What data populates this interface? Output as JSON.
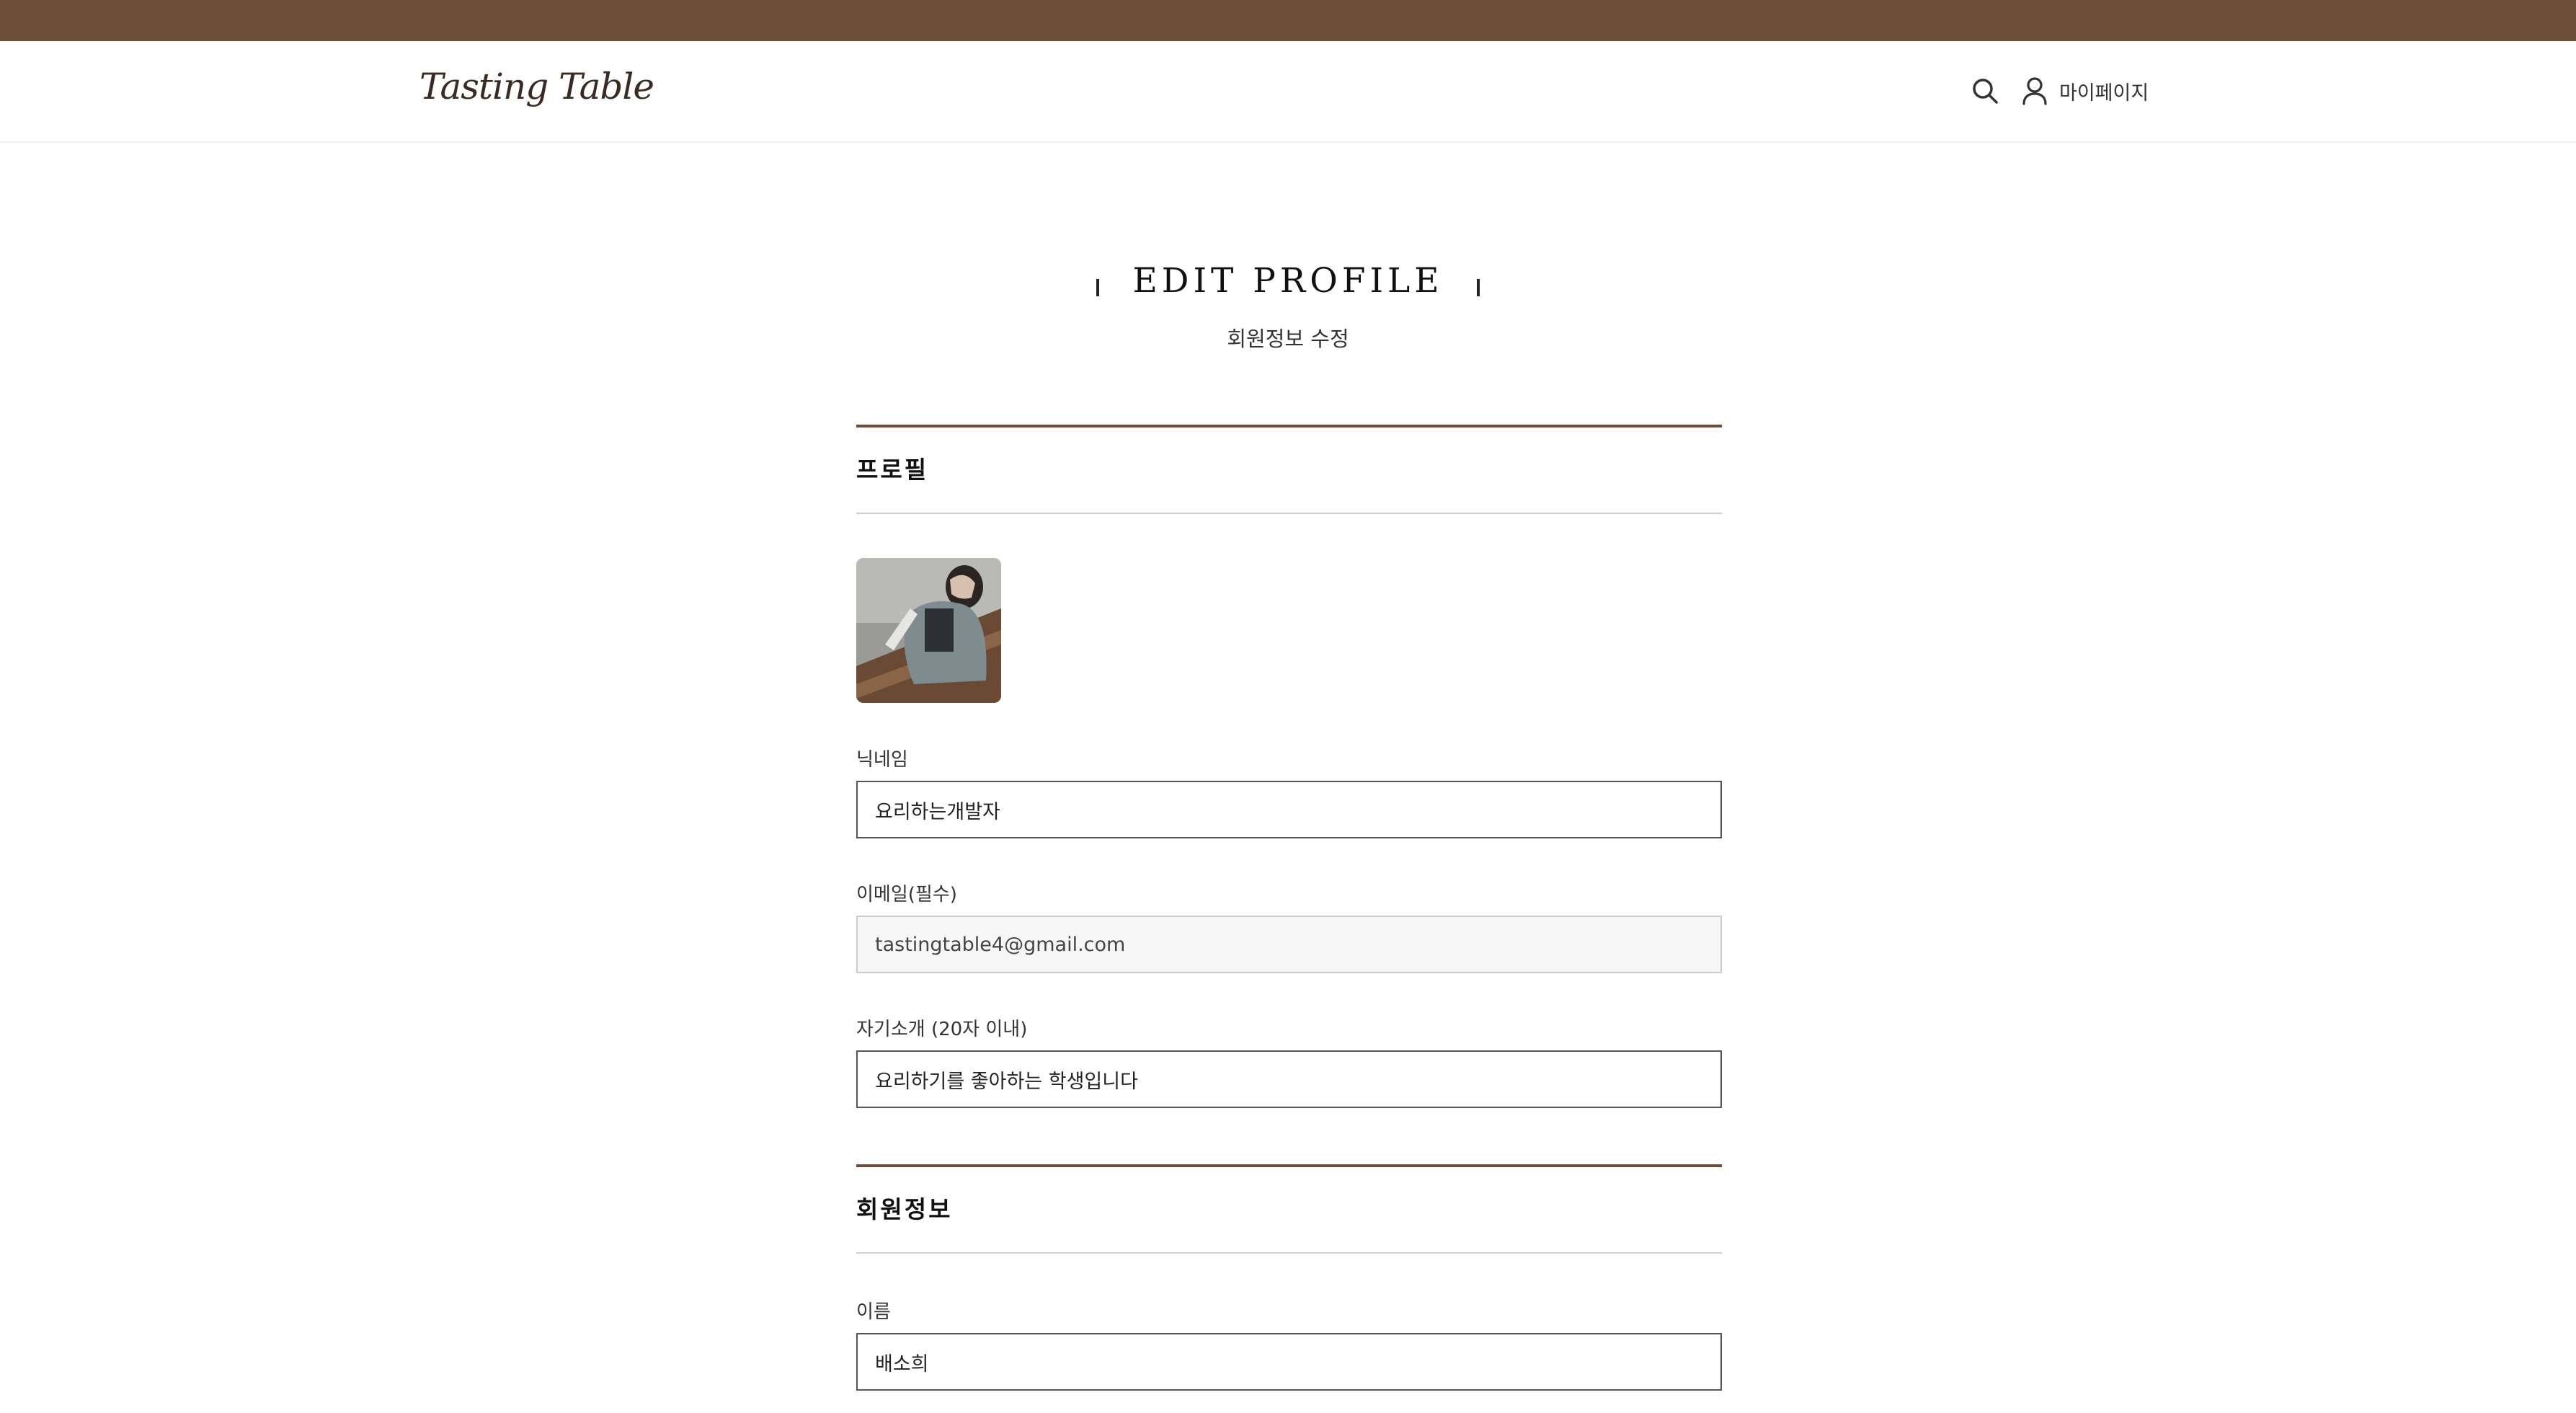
{
  "header": {
    "logo": "Tasting Table",
    "mypage_label": "마이페이지"
  },
  "page": {
    "title": "EDIT PROFILE",
    "subtitle": "회원정보 수정"
  },
  "profile_section": {
    "heading": "프로필",
    "nickname": {
      "label": "닉네임",
      "value": "요리하는개발자"
    },
    "email": {
      "label": "이메일(필수)",
      "value": "tastingtable4@gmail.com"
    },
    "bio": {
      "label": "자기소개 (20자 이내)",
      "value": "요리하기를 좋아하는 학생입니다"
    }
  },
  "member_section": {
    "heading": "회원정보",
    "name": {
      "label": "이름",
      "value": "배소희"
    }
  },
  "colors": {
    "brand_brown": "#6f4e37",
    "field_border": "#555555",
    "disabled_bg": "#f6f6f6"
  },
  "icons": {
    "search": "search-icon",
    "user": "user-icon"
  }
}
